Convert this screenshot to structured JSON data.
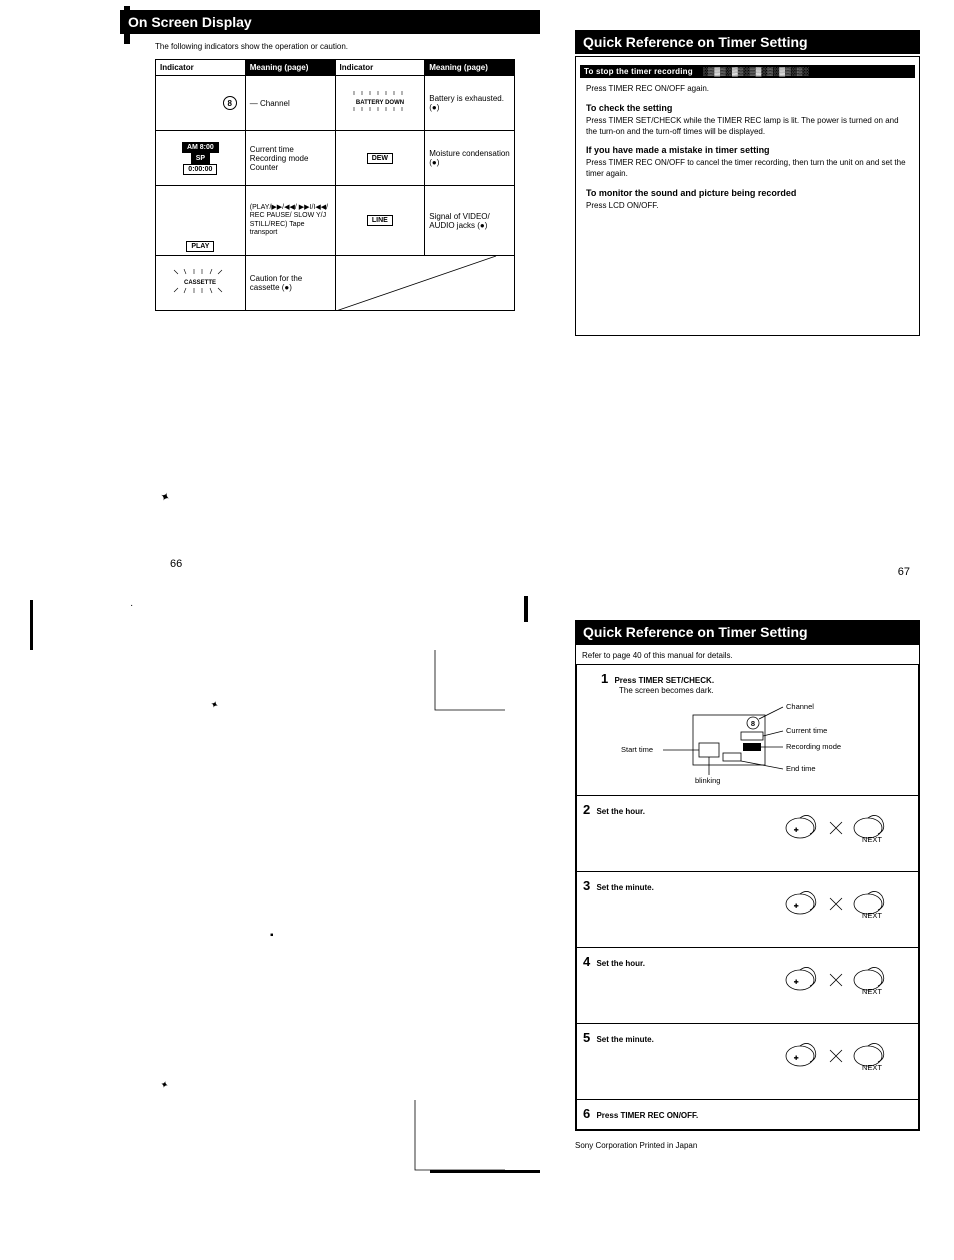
{
  "top_left": {
    "title": "On Screen Display",
    "intro": "The following indicators show the operation or caution.",
    "headers": [
      "Indicator",
      "Meaning (page)",
      "Indicator",
      "Meaning (page)"
    ],
    "rows": [
      {
        "l_icon": "channel-8-icon",
        "l_label": "8",
        "l_mean": "Channel",
        "r_icon": "battery-down-icon",
        "r_label": "BATTERY DOWN",
        "r_mean": "Battery is exhausted. (●)"
      },
      {
        "l_icon": "clock-mode-counter-icon",
        "l_label_1": "AM 8:00",
        "l_label_2": "SP",
        "l_label_3": "0:00:00",
        "l_mean": "Current time\nRecording mode\nCounter",
        "r_icon": "dew-icon",
        "r_label": "DEW",
        "r_mean": "Moisture condensation (●)"
      },
      {
        "l_icon": "play-transport-icon",
        "l_label": "PLAY",
        "l_mean": "(PLAY/▶▶/◀◀/ ▶▶I/I◀◀/ REC PAUSE/ SLOW Y/J STILL/REC) Tape transport",
        "r_icon": "line-icon",
        "r_label": "LINE",
        "r_mean": "Signal of VIDEO/ AUDIO jacks (●)"
      },
      {
        "l_icon": "cassette-icon",
        "l_label": "CASSETTE",
        "l_mean": "Caution for the cassette (●)",
        "r_icon": "",
        "r_label": "",
        "r_mean": ""
      }
    ],
    "page_num": "66"
  },
  "top_right": {
    "title": "Quick Reference on Timer Setting",
    "bar": "To stop the timer recording",
    "p1": "Press TIMER REC ON/OFF again.",
    "h2": "To check the setting",
    "p2": "Press TIMER SET/CHECK while the TIMER REC lamp is lit. The power is turned on and the turn-on and the turn-off times will be displayed.",
    "h3": "If you have made a mistake in timer setting",
    "p3": "Press TIMER REC ON/OFF to cancel the timer recording, then turn the unit on and set the timer again.",
    "h4": "To monitor the sound and picture being recorded",
    "p4": "Press LCD ON/OFF.",
    "page_num": "67"
  },
  "bottom_right": {
    "title": "Quick Reference on Timer Setting",
    "intro": "Refer to page 40 of this manual for details.",
    "step1": {
      "num": "1",
      "title": "Press TIMER SET/CHECK.",
      "sub": "The screen becomes dark.",
      "labels": {
        "channel": "Channel",
        "channel_val": "8",
        "current_time": "Current time",
        "recording_mode": "Recording mode",
        "start_time": "Start time",
        "end_time": "End time",
        "blinking": "blinking"
      }
    },
    "step2": {
      "num": "2",
      "title": "Set the hour.",
      "btn_hint": "NEXT"
    },
    "step3": {
      "num": "3",
      "title": "Set the minute.",
      "btn_hint": "NEXT"
    },
    "step4": {
      "num": "4",
      "title": "Set the hour.",
      "btn_hint": "NEXT"
    },
    "step5": {
      "num": "5",
      "title": "Set the minute.",
      "btn_hint": "NEXT"
    },
    "step6": {
      "num": "6",
      "title": "Press TIMER REC ON/OFF."
    },
    "footer": "Sony Corporation    Printed in Japan"
  }
}
